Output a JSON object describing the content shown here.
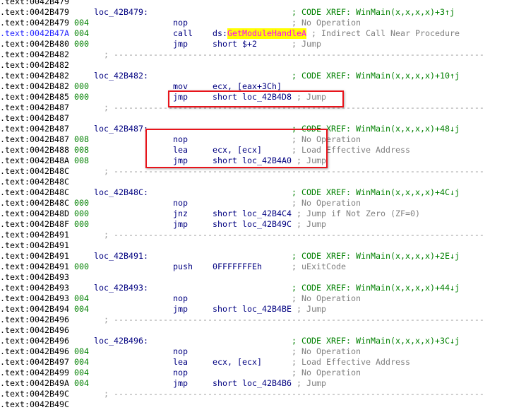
{
  "colors": {
    "highlight_box": "#e8141b",
    "xref": "#008000",
    "stack": "#008000",
    "code": "#000080",
    "comment": "#808080",
    "name_highlight_fg": "#ff00ff",
    "name_highlight_bg": "#ffff00"
  },
  "lines": [
    {
      "addr": ".text:0042B479"
    },
    {
      "addr": ".text:0042B479",
      "label": "loc_42B479:",
      "comment": "; CODE XREF: WinMain(x,x,x,x)+3↑j",
      "xref": true
    },
    {
      "addr": ".text:0042B479",
      "stack": "004",
      "mnem": "nop",
      "comment": "; No Operation"
    },
    {
      "addr": ".text:0042B47A",
      "current": true,
      "stack": "004",
      "mnem": "call",
      "op": "ds:",
      "op_highlight": "GetModuleHandleA",
      "comment": "; Indirect Call Near Procedure"
    },
    {
      "addr": ".text:0042B480",
      "stack": "000",
      "mnem": "jmp",
      "op": "short $+2",
      "comment": "; Jump"
    },
    {
      "addr": ".text:0042B482",
      "sep": "; ---------------------------------------------------------------------------"
    },
    {
      "addr": ".text:0042B482"
    },
    {
      "addr": ".text:0042B482",
      "label": "loc_42B482:",
      "comment": "; CODE XREF: WinMain(x,x,x,x)+10↑j",
      "xref": true
    },
    {
      "addr": ".text:0042B482",
      "stack": "000",
      "mnem": "mov",
      "op": "ecx, [eax+3Ch]"
    },
    {
      "addr": ".text:0042B485",
      "stack": "000",
      "mnem": "jmp",
      "op": "short loc_42B4D8",
      "comment": "; Jump"
    },
    {
      "addr": ".text:0042B487",
      "sep": "; ---------------------------------------------------------------------------"
    },
    {
      "addr": ".text:0042B487"
    },
    {
      "addr": ".text:0042B487",
      "label": "loc_42B487:",
      "comment": "; CODE XREF: WinMain(x,x,x,x)+48↓j",
      "xref": true
    },
    {
      "addr": ".text:0042B487",
      "stack": "008",
      "mnem": "nop",
      "comment": "; No Operation"
    },
    {
      "addr": ".text:0042B488",
      "stack": "008",
      "mnem": "lea",
      "op": "ecx, [ecx]",
      "comment": "; Load Effective Address"
    },
    {
      "addr": ".text:0042B48A",
      "stack": "008",
      "mnem": "jmp",
      "op": "short loc_42B4A0",
      "comment": "; Jump"
    },
    {
      "addr": ".text:0042B48C",
      "sep": "; ---------------------------------------------------------------------------"
    },
    {
      "addr": ".text:0042B48C"
    },
    {
      "addr": ".text:0042B48C",
      "label": "loc_42B48C:",
      "comment": "; CODE XREF: WinMain(x,x,x,x)+4C↓j",
      "xref": true
    },
    {
      "addr": ".text:0042B48C",
      "stack": "000",
      "mnem": "nop",
      "comment": "; No Operation"
    },
    {
      "addr": ".text:0042B48D",
      "stack": "000",
      "mnem": "jnz",
      "op": "short loc_42B4C4",
      "comment": "; Jump if Not Zero (ZF=0)"
    },
    {
      "addr": ".text:0042B48F",
      "stack": "000",
      "mnem": "jmp",
      "op": "short loc_42B49C",
      "comment": "; Jump"
    },
    {
      "addr": ".text:0042B491",
      "sep": "; ---------------------------------------------------------------------------"
    },
    {
      "addr": ".text:0042B491"
    },
    {
      "addr": ".text:0042B491",
      "label": "loc_42B491:",
      "comment": "; CODE XREF: WinMain(x,x,x,x)+2E↓j",
      "xref": true
    },
    {
      "addr": ".text:0042B491",
      "stack": "000",
      "mnem": "push",
      "op": "0FFFFFFFEh",
      "comment": "; uExitCode"
    },
    {
      "addr": ".text:0042B493"
    },
    {
      "addr": ".text:0042B493",
      "label": "loc_42B493:",
      "comment": "; CODE XREF: WinMain(x,x,x,x)+44↓j",
      "xref": true
    },
    {
      "addr": ".text:0042B493",
      "stack": "004",
      "mnem": "nop",
      "comment": "; No Operation"
    },
    {
      "addr": ".text:0042B494",
      "stack": "004",
      "mnem": "jmp",
      "op": "short loc_42B4BE",
      "comment": "; Jump"
    },
    {
      "addr": ".text:0042B496",
      "sep": "; ---------------------------------------------------------------------------"
    },
    {
      "addr": ".text:0042B496"
    },
    {
      "addr": ".text:0042B496",
      "label": "loc_42B496:",
      "comment": "; CODE XREF: WinMain(x,x,x,x)+3C↓j",
      "xref": true
    },
    {
      "addr": ".text:0042B496",
      "stack": "004",
      "mnem": "nop",
      "comment": "; No Operation"
    },
    {
      "addr": ".text:0042B497",
      "stack": "004",
      "mnem": "lea",
      "op": "ecx, [ecx]",
      "comment": "; Load Effective Address"
    },
    {
      "addr": ".text:0042B499",
      "stack": "004",
      "mnem": "nop",
      "comment": "; No Operation"
    },
    {
      "addr": ".text:0042B49A",
      "stack": "004",
      "mnem": "jmp",
      "op": "short loc_42B4B6",
      "comment": "; Jump"
    },
    {
      "addr": ".text:0042B49C",
      "sep": "; ---------------------------------------------------------------------------"
    },
    {
      "addr": ".text:0042B49C"
    }
  ]
}
